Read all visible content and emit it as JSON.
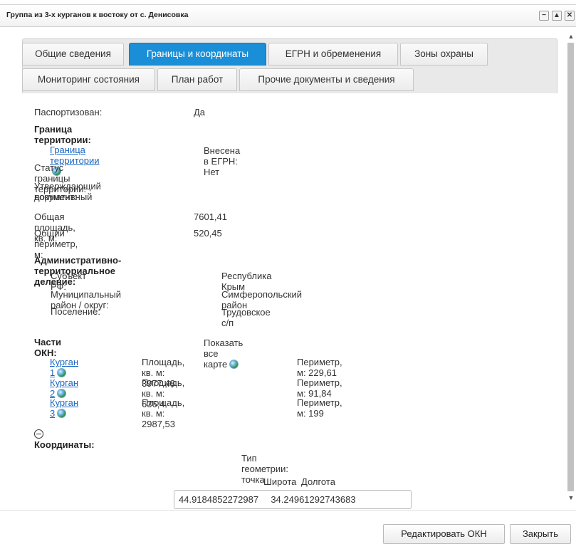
{
  "window": {
    "title": "Группа из 3-х курганов к востоку от с. Денисовка",
    "minimize_label": "−",
    "maximize_label": "▲",
    "close_label": "✕"
  },
  "tabs": {
    "row1": [
      "Общие сведения",
      "Границы и координаты",
      "ЕГРН и обременения",
      "Зоны охраны"
    ],
    "row2": [
      "Мониторинг состояния",
      "План работ",
      "Прочие документы и сведения"
    ],
    "active": "Границы и координаты"
  },
  "fields": {
    "passported_label": "Паспортизован:",
    "passported_value": "Да",
    "territory_heading": "Граница территории:",
    "territory_link": "Граница территории",
    "egrn_status": "Внесена в ЕГРН: Нет",
    "territory_status_label": "Статус границы территории:",
    "approving_doc_label_1": "Утверждающий нормативный",
    "approving_doc_label_2": "документ:",
    "area_label": "Общая площадь, кв. м:",
    "area_value": "7601,41",
    "perimeter_label": "Общий периметр, м:",
    "perimeter_value": "520,45"
  },
  "admin": {
    "heading": "Административно-территориальное деление:",
    "subject_label": "Субъект РФ:",
    "subject_value": "Республика Крым",
    "district_label": "Муниципальный район / округ:",
    "district_value": "Симферопольский район",
    "settlement_label": "Поселение:",
    "settlement_value": "Трудовское с/п"
  },
  "parts": {
    "heading": "Части ОКН:",
    "show_all": "Показать все карте",
    "items": [
      {
        "name": "Курган 1",
        "area": "Площадь, кв. м: 3977,48",
        "perimeter": "Периметр, м: 229,61"
      },
      {
        "name": "Курган 2",
        "area": "Площадь, кв. м: 636,4",
        "perimeter": "Периметр, м: 91,84"
      },
      {
        "name": "Курган 3",
        "area": "Площадь, кв. м: 2987,53",
        "perimeter": "Периметр, м: 199"
      }
    ]
  },
  "coordinates": {
    "heading": "Координаты:",
    "geometry_type": "Тип геометрии: точка",
    "lat_label": "Широта",
    "lon_label": "Долгота",
    "lat_value": "44.9184852272987",
    "lon_value": "34.24961292743683"
  },
  "footer": {
    "edit_button": "Редактировать ОКН",
    "close_button": "Закрыть"
  },
  "colors": {
    "active_tab": "#1a8fd7",
    "link": "#1a66c2"
  }
}
